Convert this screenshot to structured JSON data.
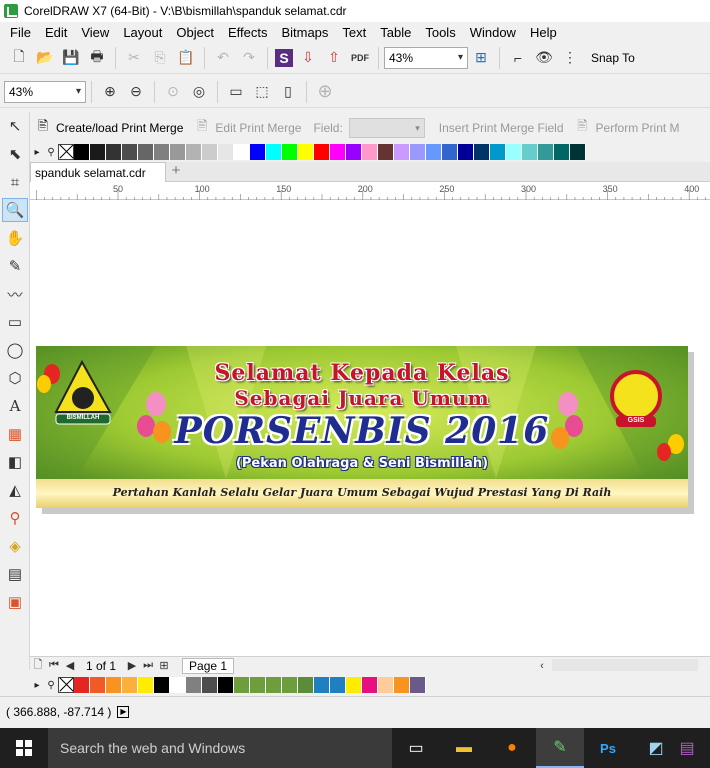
{
  "window": {
    "title": "CorelDRAW X7 (64-Bit) - V:\\B\\bismillah\\spanduk selamat.cdr"
  },
  "menu": [
    "File",
    "Edit",
    "View",
    "Layout",
    "Object",
    "Effects",
    "Bitmaps",
    "Text",
    "Table",
    "Tools",
    "Window",
    "Help"
  ],
  "standard_toolbar": {
    "zoom_value": "43%",
    "snap_label": "Snap To"
  },
  "property_bar": {
    "zoom_value": "43%"
  },
  "merge_bar": {
    "create_label": "Create/load Print Merge",
    "edit_label": "Edit Print Merge",
    "field_label": "Field:",
    "insert_label": "Insert Print Merge Field",
    "perform_label": "Perform Print M"
  },
  "document": {
    "tab_name": "spanduk selamat.cdr"
  },
  "ruler": {
    "ticks": [
      "50",
      "100",
      "150",
      "200",
      "250",
      "300",
      "350",
      "400"
    ]
  },
  "banner": {
    "line1": "Selamat Kepada Kelas",
    "line2": "Sebagai Juara Umum",
    "line3": "PORSENBIS 2016",
    "line4": "(Pekan Olahraga & Seni Bismillah)",
    "line5": "Pertahan Kanlah Selalu Gelar Juara Umum Sebagai Wujud Prestasi Yang Di Raih",
    "logo_left_text": "BISMILLAH",
    "logo_right_text": "GSIS"
  },
  "page_nav": {
    "count": "1 of 1",
    "page_tab": "Page 1"
  },
  "status": {
    "coords": "( 366.888, -87.714 )"
  },
  "taskbar": {
    "search_placeholder": "Search the web and Windows"
  },
  "colors": {
    "palette_top": [
      "#000000",
      "#1a1a1a",
      "#333333",
      "#4d4d4d",
      "#666666",
      "#808080",
      "#999999",
      "#b3b3b3",
      "#cccccc",
      "#e6e6e6",
      "#ffffff",
      "#0000ff",
      "#00ffff",
      "#00ff00",
      "#ffff00",
      "#ff0000",
      "#ff00ff",
      "#9900ff",
      "#ff99cc",
      "#663333",
      "#cc99ff",
      "#9999ff",
      "#6699ff",
      "#3366cc",
      "#000099",
      "#003366",
      "#0099cc",
      "#99ffff",
      "#66cccc",
      "#339999",
      "#006666",
      "#003333"
    ],
    "palette_bottom": [
      "#e52521",
      "#f15a24",
      "#f7931e",
      "#fbb03b",
      "#ffed00",
      "#000000",
      "#ffffff",
      "#808080",
      "#4d4d4d",
      "#000000",
      "#6e9e3c",
      "#6e9e3c",
      "#6e9e3c",
      "#6e9e3c",
      "#5b8c3a",
      "#1e7fc1",
      "#1e7fc1",
      "#ffed00",
      "#e8107f",
      "#ffcc99",
      "#f7931e",
      "#6a5a8a"
    ]
  }
}
